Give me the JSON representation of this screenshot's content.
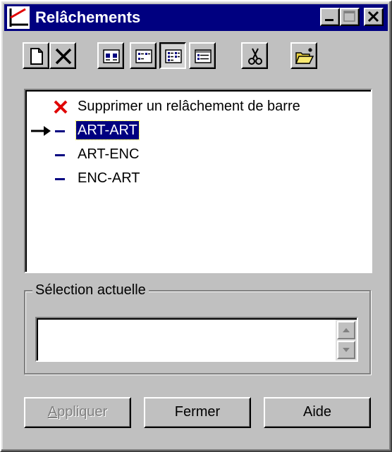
{
  "window": {
    "title": "Relâchements",
    "controls": [
      "minimize-icon",
      "maximize-icon",
      "close-icon"
    ]
  },
  "toolbar": {
    "buttons": [
      {
        "icon": "new-document-icon"
      },
      {
        "icon": "delete-x-icon"
      },
      {
        "icon": "large-icons-view-icon"
      },
      {
        "icon": "small-icons-view-icon"
      },
      {
        "icon": "list-view-icon",
        "pressed": true
      },
      {
        "icon": "details-view-icon"
      },
      {
        "icon": "scissors-icon"
      },
      {
        "icon": "open-folder-icon"
      }
    ]
  },
  "list": {
    "items": [
      {
        "label": "Supprimer un relâchement de barre",
        "icon": "red-x-icon"
      },
      {
        "label": "ART-ART",
        "icon": "dash-icon",
        "selected": true,
        "current_marker": "arrow-icon"
      },
      {
        "label": "ART-ENC",
        "icon": "dash-icon"
      },
      {
        "label": "ENC-ART",
        "icon": "dash-icon"
      }
    ]
  },
  "current_selection": {
    "group_label": "Sélection actuelle",
    "value": ""
  },
  "buttons": {
    "apply_first": "A",
    "apply_rest": "ppliquer",
    "close": "Fermer",
    "help": "Aide"
  },
  "colors": {
    "title_bar": "#000080",
    "delete_red": "#e00000",
    "dash_blue": "#000080",
    "face": "#c0c0c0"
  }
}
